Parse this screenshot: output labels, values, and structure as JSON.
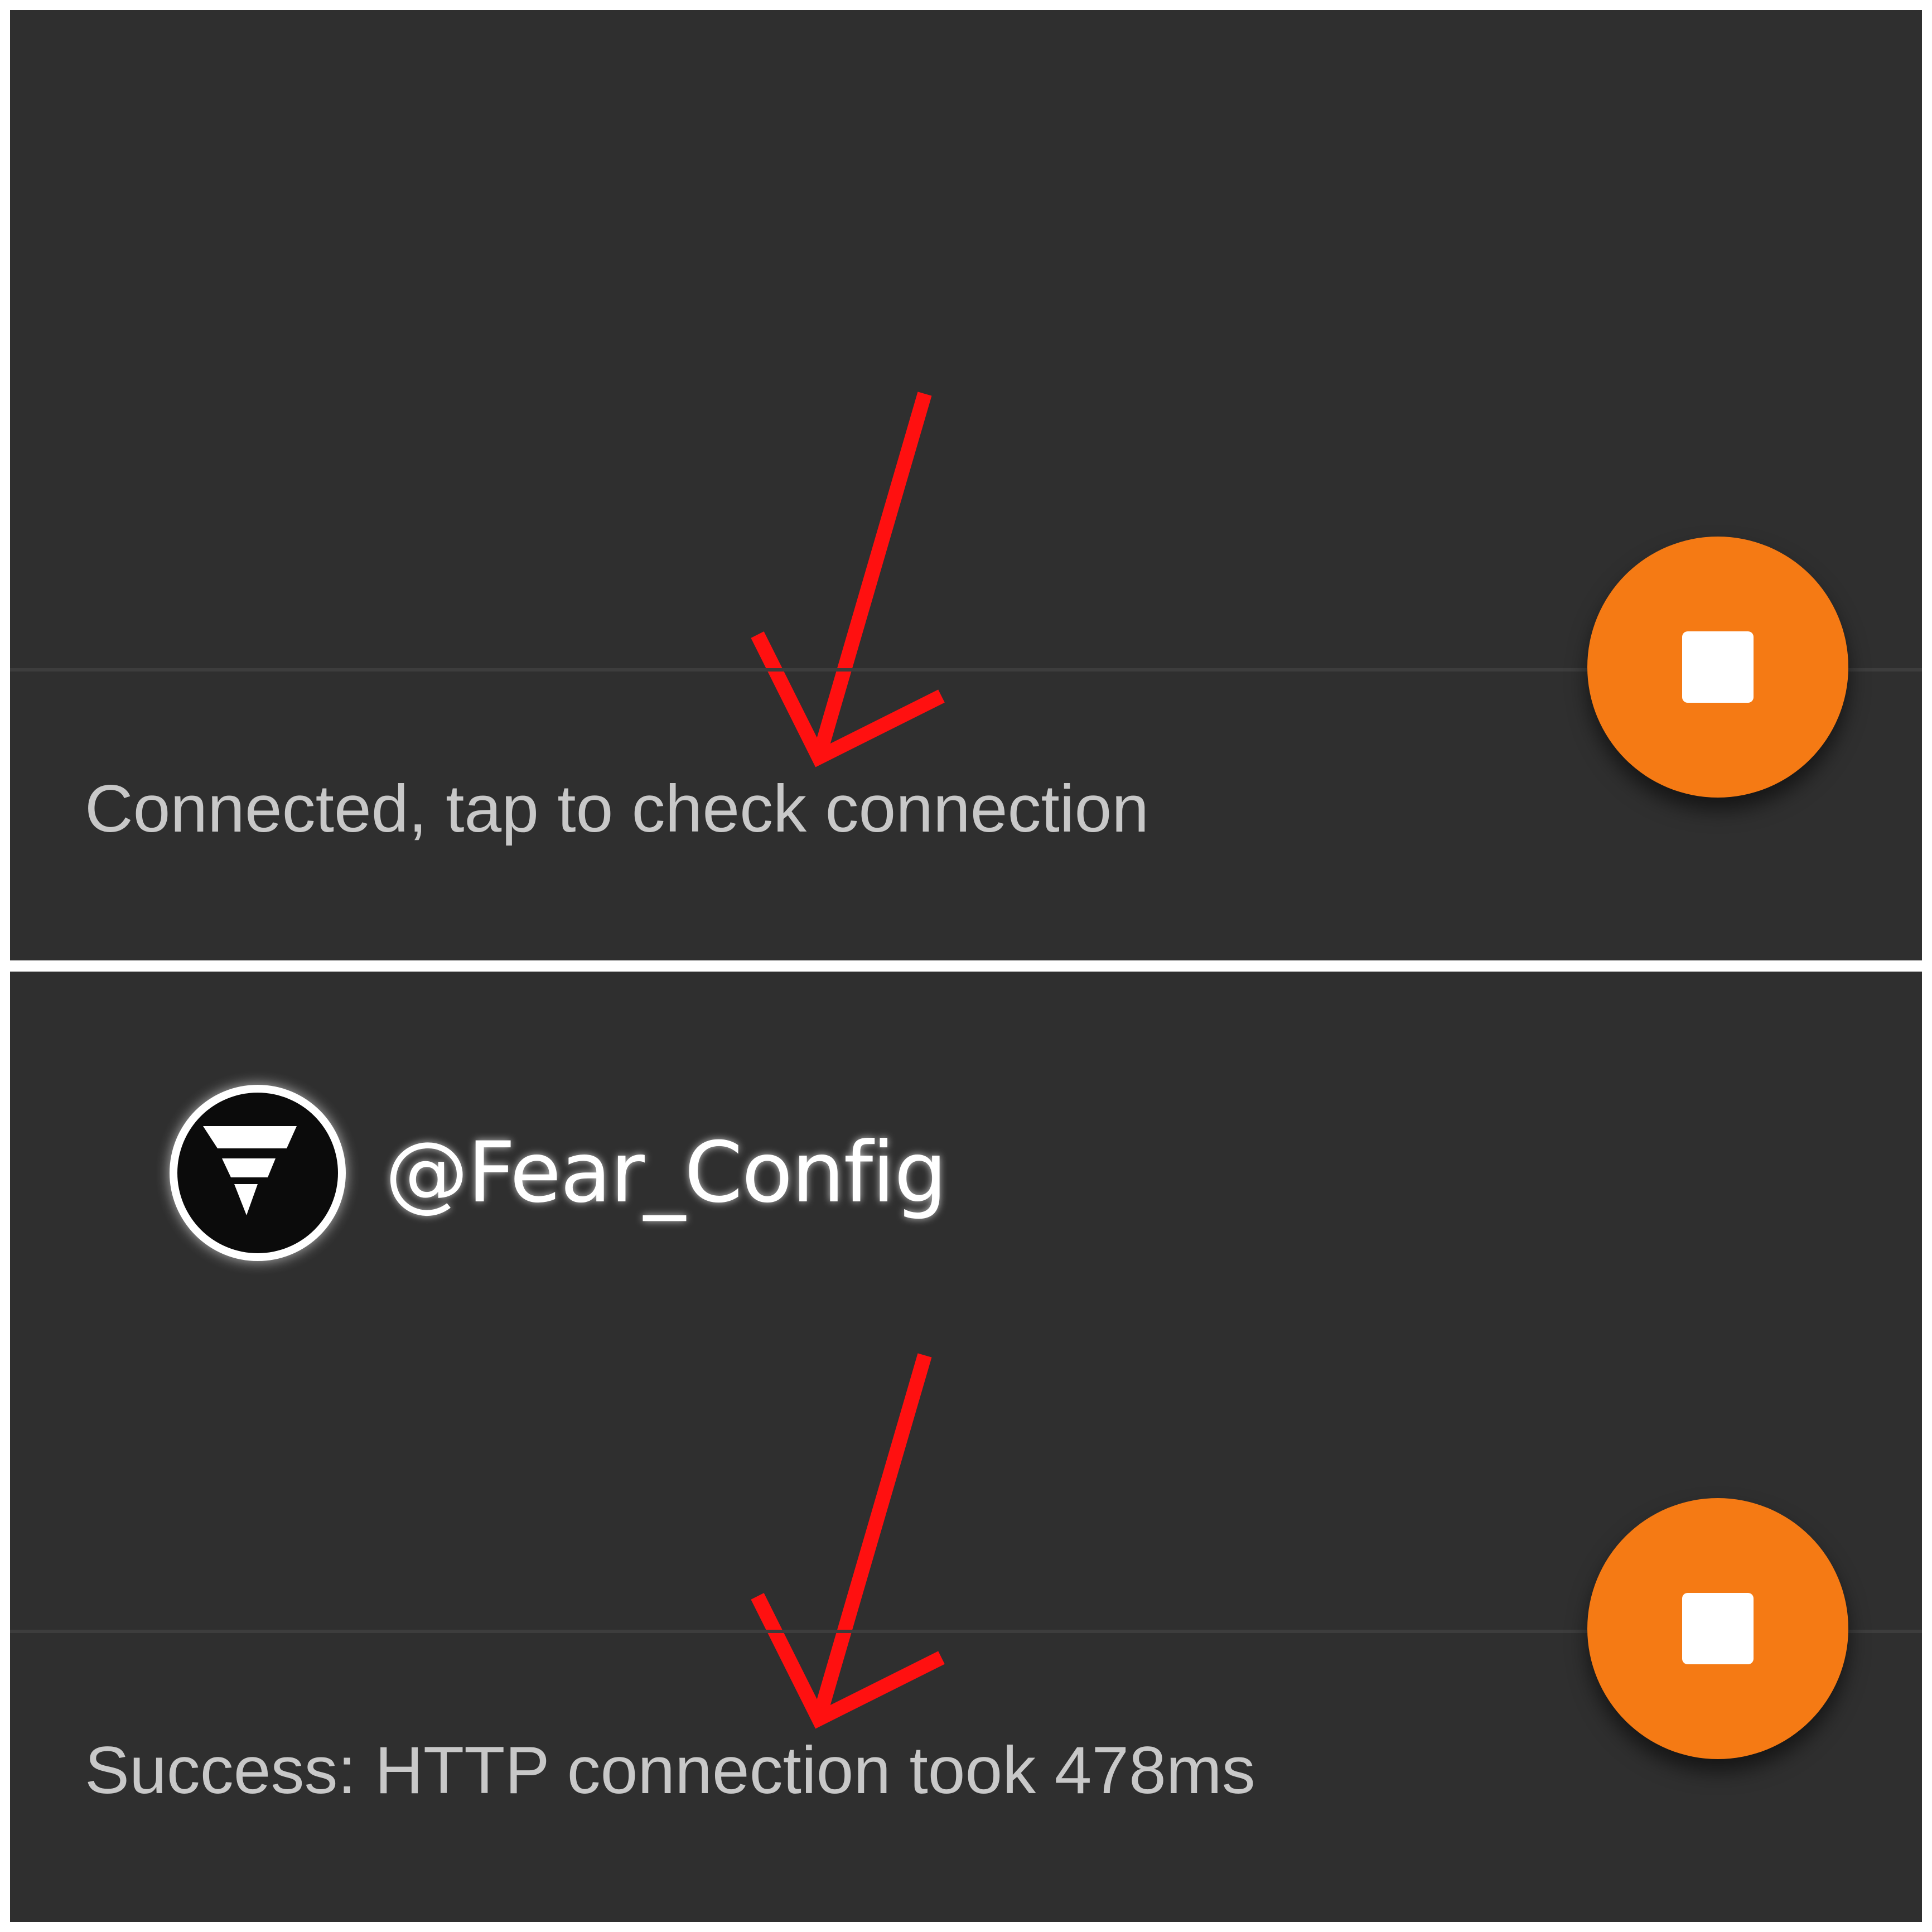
{
  "panels": [
    {
      "status_text": "Connected, tap to check connection"
    },
    {
      "watermark": {
        "handle": "@Fear_Config"
      },
      "status_text": "Success: HTTP connection took 478ms"
    }
  ],
  "colors": {
    "background": "#2f2f2f",
    "fab": "#f57a14",
    "status_text": "#c8c8c8",
    "annotation_arrow": "#ff0000"
  },
  "icons": {
    "fab": "stop-icon",
    "annotation": "red-arrow-annotation",
    "watermark_logo": "fear-config-logo"
  }
}
